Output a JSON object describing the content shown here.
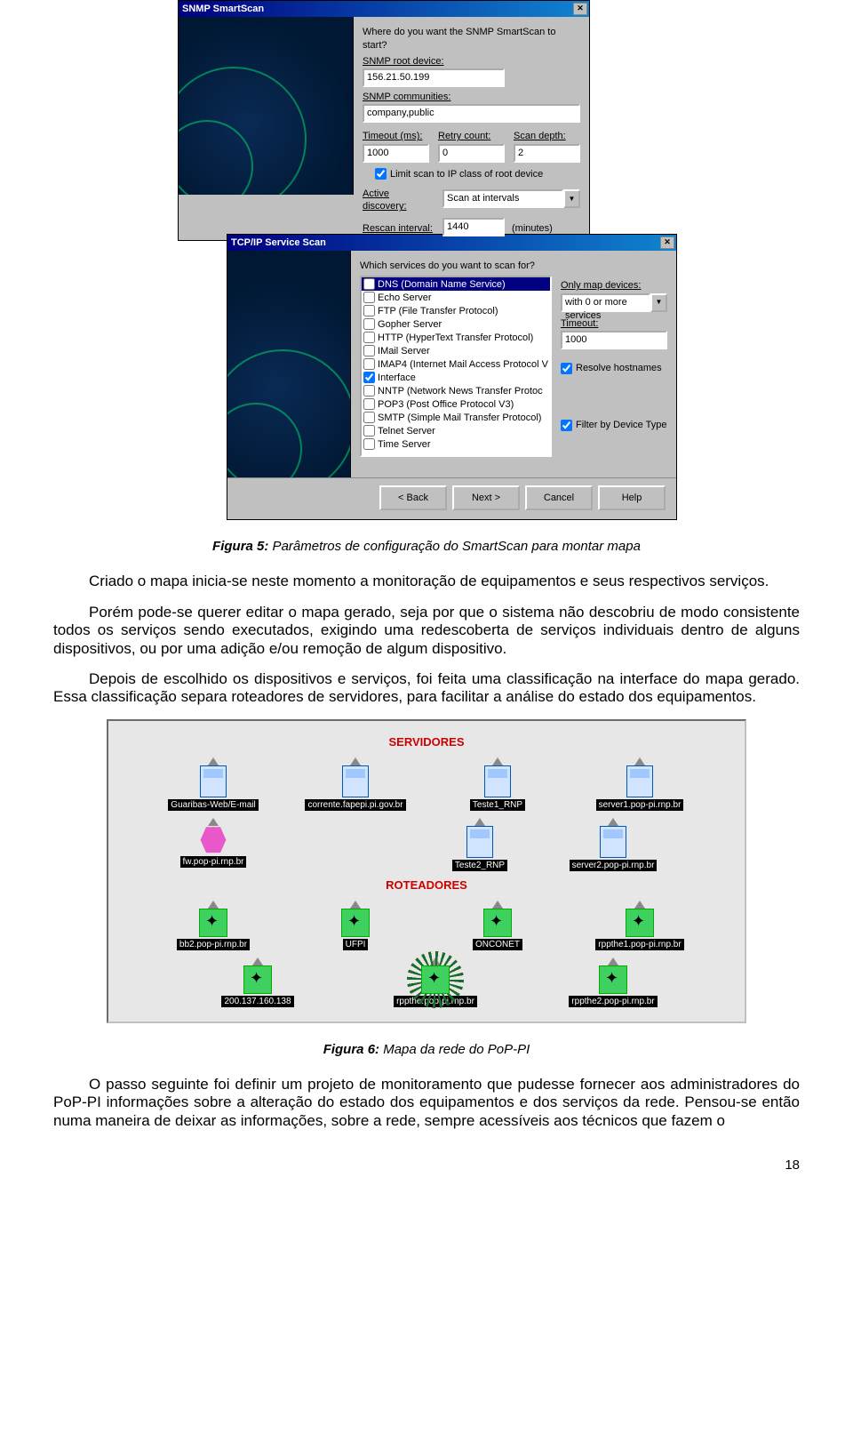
{
  "smartscan": {
    "title": "SNMP SmartScan",
    "q": "Where do you want the SNMP SmartScan to start?",
    "root_label": "SNMP root device:",
    "root_value": "156.21.50.199",
    "comm_label": "SNMP communities:",
    "comm_value": "company,public",
    "timeout_label": "Timeout (ms):",
    "timeout_value": "1000",
    "retry_label": "Retry count:",
    "retry_value": "0",
    "depth_label": "Scan depth:",
    "depth_value": "2",
    "limit_check": "Limit scan to IP class of root device",
    "active_label": "Active discovery:",
    "active_value": "Scan at intervals",
    "rescan_label": "Rescan interval:",
    "rescan_value": "1440",
    "rescan_unit": "(minutes)"
  },
  "tcpscan": {
    "title": "TCP/IP Service Scan",
    "q": "Which services do you want to scan for?",
    "services": [
      {
        "checked": false,
        "label": "DNS (Domain Name Service)"
      },
      {
        "checked": false,
        "label": "Echo Server"
      },
      {
        "checked": false,
        "label": "FTP (File Transfer Protocol)"
      },
      {
        "checked": false,
        "label": "Gopher Server"
      },
      {
        "checked": false,
        "label": "HTTP (HyperText Transfer Protocol)"
      },
      {
        "checked": false,
        "label": "IMail Server"
      },
      {
        "checked": false,
        "label": "IMAP4 (Internet Mail Access Protocol V"
      },
      {
        "checked": true,
        "label": "Interface"
      },
      {
        "checked": false,
        "label": "NNTP (Network News Transfer Protoc"
      },
      {
        "checked": false,
        "label": "POP3 (Post Office Protocol V3)"
      },
      {
        "checked": false,
        "label": "SMTP (Simple Mail Transfer Protocol)"
      },
      {
        "checked": false,
        "label": "Telnet Server"
      },
      {
        "checked": false,
        "label": "Time Server"
      }
    ],
    "only_map_label": "Only map devices:",
    "only_map_value": "with 0 or more services",
    "timeout_label": "Timeout:",
    "timeout_value": "1000",
    "resolve_check": "Resolve hostnames",
    "filter_check": "Filter by Device Type",
    "back": "< Back",
    "next": "Next >",
    "cancel": "Cancel",
    "help": "Help"
  },
  "fig5_caption_bold": "Figura 5:",
  "fig5_caption": " Parâmetros de configuração do SmartScan para montar mapa",
  "para1": "Criado o mapa inicia-se neste momento a monitoração de equipamentos e seus respectivos serviços.",
  "para2": "Porém pode-se querer editar o mapa gerado, seja por que o sistema não descobriu de modo consistente todos os serviços sendo executados, exigindo uma redescoberta de serviços individuais dentro de alguns dispositivos, ou por uma adição e/ou remoção de algum dispositivo.",
  "para3": "Depois de escolhido os dispositivos e serviços, foi feita uma classificação na interface do mapa gerado. Essa classificação separa roteadores de servidores, para facilitar a análise do estado dos equipamentos.",
  "netmap": {
    "servers_title": "SERVIDORES",
    "servers_row1": [
      "Guaribas-Web/E-mail",
      "corrente.fapepi.pi.gov.br",
      "Teste1_RNP",
      "server1.pop-pi.rnp.br"
    ],
    "servers_row2": [
      "fw.pop-pi.rnp.br",
      "Teste2_RNP",
      "server2.pop-pi.rnp.br"
    ],
    "routers_title": "ROTEADORES",
    "routers_row1": [
      "bb2.pop-pi.rnp.br",
      "UFPI",
      "ONCONET",
      "rppthe1.pop-pi.rnp.br"
    ],
    "routers_row2": [
      "200.137.160.138",
      "rppthe.pop-pi.rnp.br",
      "rppthe2.pop-pi.rnp.br"
    ]
  },
  "fig6_caption_bold": "Figura 6:",
  "fig6_caption": " Mapa da rede do PoP-PI",
  "para4": "O passo seguinte foi definir um projeto de monitoramento que pudesse fornecer aos administradores do PoP-PI informações sobre a alteração do estado dos equipamentos e dos serviços da rede. Pensou-se então numa maneira de deixar as informações, sobre a rede, sempre acessíveis aos técnicos que fazem o",
  "pagenum": "18"
}
